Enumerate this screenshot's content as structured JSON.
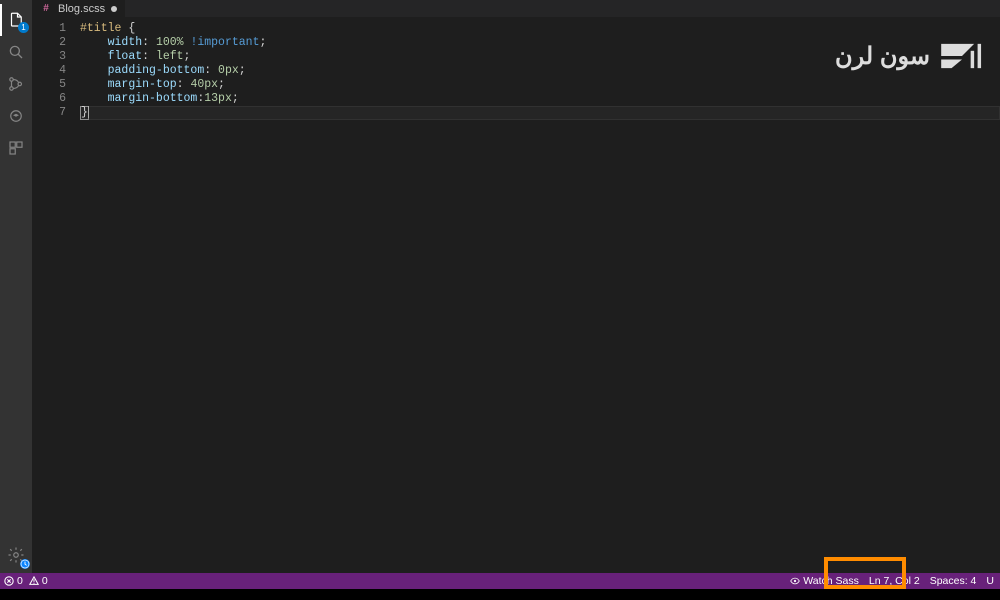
{
  "tab": {
    "filename": "Blog.scss",
    "dirty": true,
    "icon": "scss-icon"
  },
  "activity": {
    "explorer_badge": "1"
  },
  "code": {
    "lines": [
      {
        "n": "1",
        "tokens": [
          {
            "t": "#title",
            "c": "tok-sel"
          },
          {
            "t": " ",
            "c": ""
          },
          {
            "t": "{",
            "c": "tok-brace"
          }
        ]
      },
      {
        "n": "2",
        "tokens": [
          {
            "t": "    ",
            "c": ""
          },
          {
            "t": "width",
            "c": "tok-prop"
          },
          {
            "t": ": ",
            "c": "tok-punc"
          },
          {
            "t": "100%",
            "c": "tok-num"
          },
          {
            "t": " ",
            "c": ""
          },
          {
            "t": "!important",
            "c": "tok-imp"
          },
          {
            "t": ";",
            "c": "tok-punc"
          }
        ]
      },
      {
        "n": "3",
        "tokens": [
          {
            "t": "    ",
            "c": ""
          },
          {
            "t": "float",
            "c": "tok-prop"
          },
          {
            "t": ": ",
            "c": "tok-punc"
          },
          {
            "t": "left",
            "c": "tok-num"
          },
          {
            "t": ";",
            "c": "tok-punc"
          }
        ]
      },
      {
        "n": "4",
        "tokens": [
          {
            "t": "    ",
            "c": ""
          },
          {
            "t": "padding-bottom",
            "c": "tok-prop"
          },
          {
            "t": ": ",
            "c": "tok-punc"
          },
          {
            "t": "0px",
            "c": "tok-num"
          },
          {
            "t": ";",
            "c": "tok-punc"
          }
        ]
      },
      {
        "n": "5",
        "tokens": [
          {
            "t": "    ",
            "c": ""
          },
          {
            "t": "margin-top",
            "c": "tok-prop"
          },
          {
            "t": ": ",
            "c": "tok-punc"
          },
          {
            "t": "40px",
            "c": "tok-num"
          },
          {
            "t": ";",
            "c": "tok-punc"
          }
        ]
      },
      {
        "n": "6",
        "tokens": [
          {
            "t": "    ",
            "c": ""
          },
          {
            "t": "margin-bottom",
            "c": "tok-prop"
          },
          {
            "t": ":",
            "c": "tok-punc"
          },
          {
            "t": "13px",
            "c": "tok-num"
          },
          {
            "t": ";",
            "c": "tok-punc"
          }
        ]
      },
      {
        "n": "7",
        "tokens": [
          {
            "t": "}",
            "c": "tok-brace bracket-hl"
          }
        ],
        "current": true,
        "cursor_after": true
      }
    ]
  },
  "status": {
    "errors": "0",
    "warnings": "0",
    "watch_sass": "Watch Sass",
    "ln_col": "Ln 7, Col 2",
    "spaces": "Spaces: 4",
    "encoding_short": "U"
  },
  "logo": {
    "text": "سون لرن"
  }
}
